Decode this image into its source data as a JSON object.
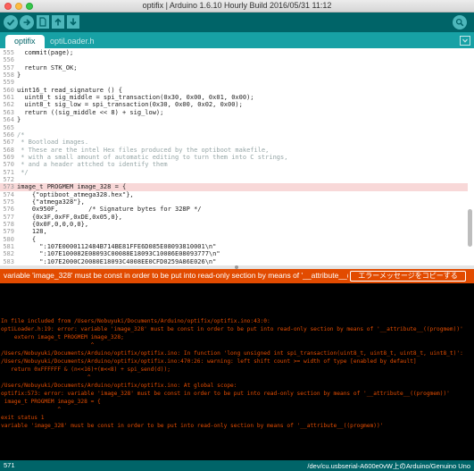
{
  "window": {
    "title": "optifix | Arduino 1.6.10 Hourly Build 2016/05/31 11:12"
  },
  "toolbar": {
    "buttons": [
      {
        "name": "verify",
        "icon": "checkmark-icon"
      },
      {
        "name": "upload",
        "icon": "right-arrow-icon"
      },
      {
        "name": "new",
        "icon": "new-file-icon"
      },
      {
        "name": "open",
        "icon": "up-arrow-icon"
      },
      {
        "name": "save",
        "icon": "down-arrow-icon"
      },
      {
        "name": "serial-monitor",
        "icon": "magnifier-icon"
      }
    ],
    "colors": {
      "background": "#006468",
      "button": "#4db7bb"
    }
  },
  "tabs": [
    {
      "label": "optifix",
      "active": true
    },
    {
      "label": "optiLoader.h",
      "active": false
    }
  ],
  "editor": {
    "cursor_after_line": "*/",
    "lines": [
      {
        "num": "555",
        "text": "  commit(page);",
        "hl": false
      },
      {
        "num": "556",
        "text": "",
        "hl": false
      },
      {
        "num": "557",
        "text": "  return STK_OK;",
        "hl": false
      },
      {
        "num": "558",
        "text": "}",
        "hl": false
      },
      {
        "num": "559",
        "text": "",
        "hl": false
      },
      {
        "num": "560",
        "text": "uint16_t read_signature () {",
        "hl": false
      },
      {
        "num": "561",
        "text": "  uint8_t sig_middle = spi_transaction(0x30, 0x00, 0x01, 0x00);",
        "hl": false
      },
      {
        "num": "562",
        "text": "  uint8_t sig_low = spi_transaction(0x30, 0x00, 0x02, 0x00);",
        "hl": false
      },
      {
        "num": "563",
        "text": "  return ((sig_middle << 8) + sig_low);",
        "hl": false
      },
      {
        "num": "564",
        "text": "}",
        "hl": false
      },
      {
        "num": "565",
        "text": "",
        "hl": false
      },
      {
        "num": "566",
        "text": "/*",
        "hl": false
      },
      {
        "num": "567",
        "text": " * Bootload images.",
        "hl": false
      },
      {
        "num": "568",
        "text": " * These are the intel Hex files produced by the optiboot makefile,",
        "hl": false
      },
      {
        "num": "569",
        "text": " * with a small amount of automatic editing to turn them into C strings,",
        "hl": false
      },
      {
        "num": "570",
        "text": " * and a header attched to identify them",
        "hl": false
      },
      {
        "num": "571",
        "text": " */",
        "hl": false
      },
      {
        "num": "572",
        "text": "",
        "hl": false
      },
      {
        "num": "573",
        "text": "image_t PROGMEM image_328 = {",
        "hl": true
      },
      {
        "num": "574",
        "text": "    {\"optiboot_atmega328.hex\"},",
        "hl": false
      },
      {
        "num": "575",
        "text": "    {\"atmega328\"},",
        "hl": false
      },
      {
        "num": "576",
        "text": "    0x950F,        /* Signature bytes for 328P */",
        "hl": false
      },
      {
        "num": "577",
        "text": "    {0x3F,0xFF,0xDE,0x05,0},",
        "hl": false
      },
      {
        "num": "578",
        "text": "    {0x0F,0,0,0,0},",
        "hl": false
      },
      {
        "num": "579",
        "text": "    128,",
        "hl": false
      },
      {
        "num": "580",
        "text": "    {",
        "hl": false
      },
      {
        "num": "581",
        "text": "      \":107E0000112484B714BE81FFE6D085E08093810001\\n\"",
        "hl": false
      },
      {
        "num": "582",
        "text": "      \":107E100082E08093C00088E18093C10086E08093777\\n\"",
        "hl": false
      },
      {
        "num": "583",
        "text": "      \":107E2000C20080E18093C4008EE0CFD0259A86E026\\n\"",
        "hl": false
      }
    ]
  },
  "errorbar": {
    "message": "variable 'image_328' must be const in order to be put into read-only section by means of '__attribute__((progmem))'",
    "copy_button": "エラーメッセージをコピーする"
  },
  "console": {
    "lines": [
      "",
      "",
      "",
      "",
      "In file included from /Users/Nobuyuki/Documents/Arduino/optifix/optifix.ino:43:0:",
      "optiLoader.h:19: error: variable 'image_328' must be const in order to be put into read-only section by means of '__attribute__((progmem))'",
      "    extern image_t PROGMEM image_328;",
      "                           ^",
      "/Users/Nobuyuki/Documents/Arduino/optifix/optifix.ino: In function 'long unsigned int spi_transaction(uint8_t, uint8_t, uint8_t, uint8_t)':",
      "/Users/Nobuyuki/Documents/Arduino/optifix/optifix.ino:470:26: warning: left shift count >= width of type [enabled by default]",
      "   return 0xFFFFFF & (n<<16)+(m<<8) + spi_send(d));",
      "                          ^",
      "/Users/Nobuyuki/Documents/Arduino/optifix/optifix.ino: At global scope:",
      "optifix:573: error: variable 'image_328' must be const in order to be put into read-only section by means of '__attribute__((progmem))'",
      " image_t PROGMEM image_328 = {",
      "                 ^",
      "exit status 1",
      "variable 'image_328' must be const in order to be put into read-only section by means of '__attribute__((progmem))'"
    ]
  },
  "statusbar": {
    "line": "571",
    "board": "/dev/cu.usbserial-A600e0vW上のArduino/Genuino Uno"
  }
}
